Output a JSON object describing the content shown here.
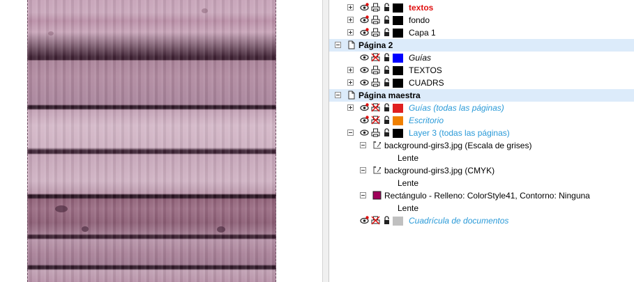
{
  "colors": {
    "panel_selected_bg": "#dcebfa",
    "label_red": "#e01010",
    "label_blue": "#2a9ad8",
    "swatch_black": "#000000",
    "swatch_blue": "#0000ff",
    "swatch_red": "#e02020",
    "swatch_orange": "#f08000",
    "swatch_gray": "#c0c0c0",
    "swatch_magenta": "#a0005a"
  },
  "layers": {
    "rows": [
      {
        "label": "textos",
        "type": "layer",
        "expander": "plus",
        "swatch": "black",
        "style": "red",
        "icons": [
          "eye-red-icon",
          "print-icon",
          "lock-icon"
        ]
      },
      {
        "label": "fondo",
        "type": "layer",
        "expander": "plus",
        "swatch": "black",
        "style": "normal",
        "icons": [
          "eye-red-icon",
          "print-icon",
          "lock-icon"
        ]
      },
      {
        "label": "Capa 1",
        "type": "layer",
        "expander": "plus",
        "swatch": "black",
        "style": "normal",
        "icons": [
          "eye-red-icon",
          "print-icon",
          "lock-icon"
        ]
      },
      {
        "label": "Página 2",
        "type": "page",
        "expander": "minus"
      },
      {
        "label": "Guías",
        "type": "layer",
        "swatch": "blue",
        "style": "italic",
        "icons": [
          "eye-icon",
          "print-disabled-icon",
          "lock-icon"
        ]
      },
      {
        "label": "TEXTOS",
        "type": "layer",
        "expander": "plus",
        "swatch": "black",
        "style": "normal",
        "icons": [
          "eye-icon",
          "print-icon",
          "lock-icon"
        ]
      },
      {
        "label": "CUADRS",
        "type": "layer",
        "expander": "plus",
        "swatch": "black",
        "style": "normal",
        "icons": [
          "eye-icon",
          "print-icon",
          "lock-icon"
        ]
      },
      {
        "label": "Página maestra",
        "type": "page",
        "expander": "minus"
      },
      {
        "label": "Guías (todas las páginas)",
        "type": "layer",
        "expander": "plus",
        "swatch": "red",
        "style": "blue-italic",
        "icons": [
          "eye-red-icon",
          "print-disabled-icon",
          "lock-icon"
        ]
      },
      {
        "label": "Escritorio",
        "type": "layer",
        "swatch": "orange",
        "style": "blue-italic",
        "icons": [
          "eye-red-icon",
          "print-disabled-icon",
          "lock-icon"
        ]
      },
      {
        "label": "Layer 3 (todas las páginas)",
        "type": "layer",
        "expander": "minus",
        "swatch": "black",
        "style": "blue",
        "icons": [
          "eye-icon",
          "print-icon",
          "lock-icon"
        ]
      },
      {
        "label": "background-girs3.jpg (Escala de grises)",
        "type": "object",
        "expander": "minus",
        "icon": "bitmap-icon"
      },
      {
        "label": "Lente",
        "type": "child"
      },
      {
        "label": "background-girs3.jpg (CMYK)",
        "type": "object",
        "expander": "minus",
        "icon": "bitmap-icon"
      },
      {
        "label": "Lente",
        "type": "child"
      },
      {
        "label": "Rectángulo - Relleno: ColorStyle41, Contorno: Ninguna",
        "type": "object",
        "expander": "minus",
        "icon": "rectangle-icon"
      },
      {
        "label": "Lente",
        "type": "child"
      },
      {
        "label": "Cuadrícula de documentos",
        "type": "layer",
        "swatch": "gray",
        "style": "blue-italic",
        "icons": [
          "eye-red-icon",
          "print-disabled-icon",
          "lock-icon"
        ]
      }
    ]
  }
}
